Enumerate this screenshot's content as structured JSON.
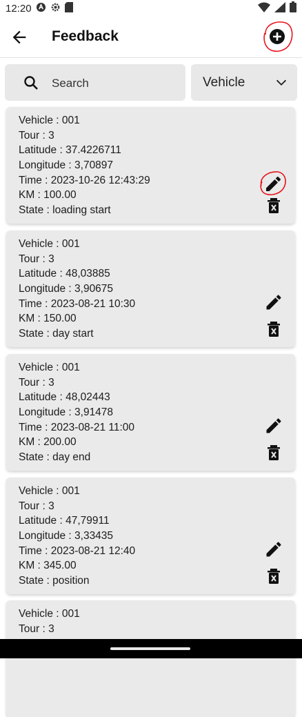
{
  "status": {
    "time": "12:20"
  },
  "header": {
    "title": "Feedback"
  },
  "search": {
    "placeholder": "Search"
  },
  "filter": {
    "selected": "Vehicle"
  },
  "labels": {
    "vehicle": "Vehicle : ",
    "tour": "Tour : ",
    "latitude": "Latitude : ",
    "longitude": "Longitude : ",
    "time": "Time : ",
    "km": "KM : ",
    "state": "State : "
  },
  "records": [
    {
      "vehicle": "001",
      "tour": "3",
      "latitude": "37.4226711",
      "longitude": "3,70897",
      "time": "2023-10-26 12:43:29",
      "km": "100.00",
      "state": "loading start"
    },
    {
      "vehicle": "001",
      "tour": "3",
      "latitude": "48,03885",
      "longitude": "3,90675",
      "time": "2023-08-21 10:30",
      "km": "150.00",
      "state": "day start"
    },
    {
      "vehicle": "001",
      "tour": "3",
      "latitude": "48,02443",
      "longitude": "3,91478",
      "time": "2023-08-21 11:00",
      "km": "200.00",
      "state": "day end"
    },
    {
      "vehicle": "001",
      "tour": "3",
      "latitude": "47,79911",
      "longitude": "3,33435",
      "time": "2023-08-21 12:40",
      "km": "345.00",
      "state": "position"
    },
    {
      "vehicle": "001",
      "tour": "3"
    }
  ],
  "colors": {
    "annotation": "#e8141c",
    "card_bg": "#eaeaea",
    "search_bg": "#e8e8e8"
  }
}
